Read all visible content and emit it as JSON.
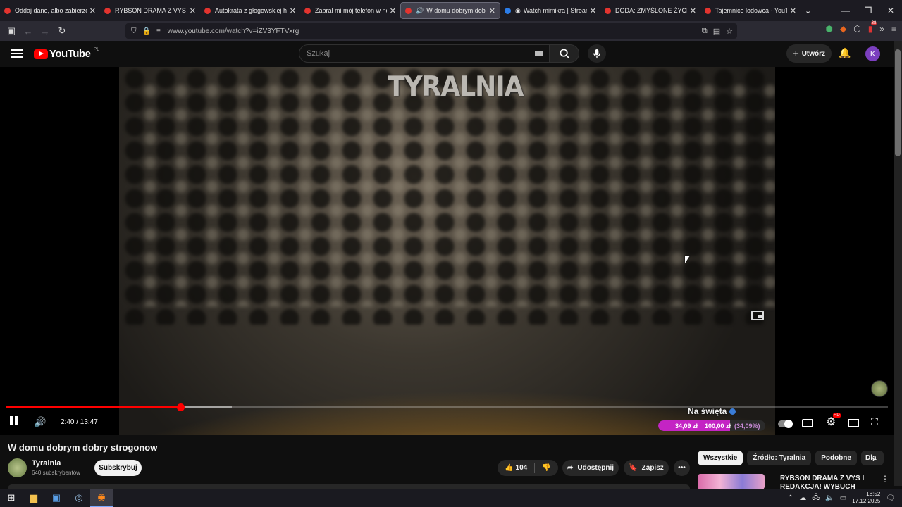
{
  "browser": {
    "tabs": [
      {
        "title": "Oddaj dane, albo zabierzemy",
        "favicon": "youtube-icon",
        "active": false
      },
      {
        "title": "RYBSON DRAMA Z VYS I REDA",
        "favicon": "youtube-icon",
        "active": false
      },
      {
        "title": "Autokrata z głogowskiej huty",
        "favicon": "youtube-icon",
        "active": false
      },
      {
        "title": "Zabrał mi mój telefon w nocy",
        "favicon": "youtube-icon",
        "active": false
      },
      {
        "title": "W domu dobrym dobry",
        "favicon": "youtube-icon",
        "active": true
      },
      {
        "title": "Watch mimikra | Streamab",
        "favicon": "streamable-icon",
        "active": false
      },
      {
        "title": "DODA: ZMYŚLONE ŻYCIE I KA",
        "favicon": "youtube-icon",
        "active": false
      },
      {
        "title": "Tajemnice lodowca - YouTube",
        "favicon": "youtube-icon",
        "active": false
      }
    ],
    "url": "www.youtube.com/watch?v=iZV3YFTVxrg"
  },
  "youtube": {
    "logo_text": "YouTube",
    "country_code": "PL",
    "search_placeholder": "Szukaj",
    "create_label": "Utwórz",
    "avatar_letter": "K"
  },
  "player": {
    "watermark": "TYRALNIA",
    "progress": 0.1977,
    "buffered": 0.2564,
    "current_time": "2:40",
    "duration": "13:47",
    "time_display": "2:40 / 13:47",
    "chapter": "Na święta",
    "donation": {
      "current": "34,09 zł",
      "goal": "100,00 zł",
      "percent_label": "(34,09%)",
      "fraction": 0.3409
    }
  },
  "video": {
    "title": "W domu dobrym dobry strogonow",
    "channel_name": "Tyralnia",
    "subscribers": "640 subskrybentów",
    "subscribe_label": "Subskrybuj",
    "likes": "104",
    "share_label": "Udostępnij",
    "save_label": "Zapisz"
  },
  "sidebar": {
    "chips": [
      "Wszystkie",
      "Źródło: Tyralnia",
      "Podobne",
      "Dla"
    ],
    "recommendation_title": "RYBSON DRAMA Z VYS I REDAKCJA! WYBUCH"
  },
  "taskbar": {
    "time": "18:52",
    "date": "17.12.2025"
  },
  "colors": {
    "youtube_red": "#ff0000",
    "donation_bar": "#c424c4",
    "avatar_bg": "#7b3fbf"
  }
}
